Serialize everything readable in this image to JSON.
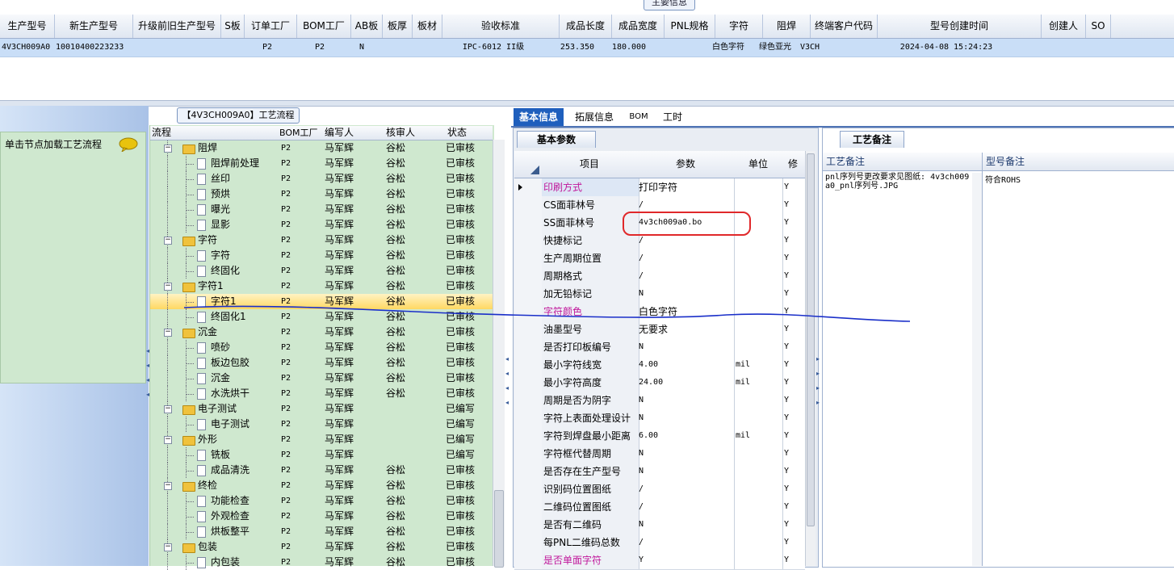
{
  "top_grid": {
    "caption": "主要信息",
    "columns": [
      {
        "label": "生产型号",
        "w": 67
      },
      {
        "label": "新生产型号",
        "w": 96
      },
      {
        "label": "升级前旧生产型号",
        "w": 108
      },
      {
        "label": "S板",
        "w": 28
      },
      {
        "label": "订单工厂",
        "w": 64
      },
      {
        "label": "BOM工厂",
        "w": 66
      },
      {
        "label": "AB板",
        "w": 38
      },
      {
        "label": "板厚",
        "w": 36
      },
      {
        "label": "板材",
        "w": 36
      },
      {
        "label": "验收标准",
        "w": 144
      },
      {
        "label": "成品长度",
        "w": 64
      },
      {
        "label": "成品宽度",
        "w": 64
      },
      {
        "label": "PNL规格",
        "w": 62
      },
      {
        "label": "字符",
        "w": 58
      },
      {
        "label": "阻焊",
        "w": 58
      },
      {
        "label": "终端客户代码",
        "w": 82
      },
      {
        "label": "型号创建时间",
        "w": 202
      },
      {
        "label": "创建人",
        "w": 54
      },
      {
        "label": "SO",
        "w": 30
      }
    ],
    "row": [
      "4V3CH009A0",
      "10010400223233",
      "",
      "",
      "P2",
      "P2",
      "N",
      "",
      "",
      "IPC-6012 II级",
      "253.350",
      "180.000",
      "",
      "白色字符",
      "绿色亚光",
      "V3CH",
      "2024-04-08 15:24:23",
      "",
      ""
    ]
  },
  "left_panel": {
    "title": "单击节点加载工艺流程"
  },
  "process_tree": {
    "caption": "【4V3CH009A0】工艺流程",
    "headers": {
      "name": "流程",
      "bom": "BOM工厂",
      "writer": "编写人",
      "reviewer": "核审人",
      "status": "状态"
    },
    "rows": [
      {
        "level": 0,
        "name": "阻焊",
        "bom": "P2",
        "writer": "马军辉",
        "reviewer": "谷松",
        "status": "已审核"
      },
      {
        "level": 1,
        "name": "阻焊前处理",
        "bom": "P2",
        "writer": "马军辉",
        "reviewer": "谷松",
        "status": "已审核"
      },
      {
        "level": 1,
        "name": "丝印",
        "bom": "P2",
        "writer": "马军辉",
        "reviewer": "谷松",
        "status": "已审核"
      },
      {
        "level": 1,
        "name": "预烘",
        "bom": "P2",
        "writer": "马军辉",
        "reviewer": "谷松",
        "status": "已审核"
      },
      {
        "level": 1,
        "name": "曝光",
        "bom": "P2",
        "writer": "马军辉",
        "reviewer": "谷松",
        "status": "已审核"
      },
      {
        "level": 1,
        "name": "显影",
        "bom": "P2",
        "writer": "马军辉",
        "reviewer": "谷松",
        "status": "已审核"
      },
      {
        "level": 0,
        "name": "字符",
        "bom": "P2",
        "writer": "马军辉",
        "reviewer": "谷松",
        "status": "已审核"
      },
      {
        "level": 1,
        "name": "字符",
        "bom": "P2",
        "writer": "马军辉",
        "reviewer": "谷松",
        "status": "已审核"
      },
      {
        "level": 1,
        "name": "终固化",
        "bom": "P2",
        "writer": "马军辉",
        "reviewer": "谷松",
        "status": "已审核"
      },
      {
        "level": 0,
        "name": "字符1",
        "bom": "P2",
        "writer": "马军辉",
        "reviewer": "谷松",
        "status": "已审核"
      },
      {
        "level": 1,
        "name": "字符1",
        "bom": "P2",
        "writer": "马军辉",
        "reviewer": "谷松",
        "status": "已审核",
        "selected": true
      },
      {
        "level": 1,
        "name": "终固化1",
        "bom": "P2",
        "writer": "马军辉",
        "reviewer": "谷松",
        "status": "已审核"
      },
      {
        "level": 0,
        "name": "沉金",
        "bom": "P2",
        "writer": "马军辉",
        "reviewer": "谷松",
        "status": "已审核"
      },
      {
        "level": 1,
        "name": "喷砂",
        "bom": "P2",
        "writer": "马军辉",
        "reviewer": "谷松",
        "status": "已审核"
      },
      {
        "level": 1,
        "name": "板边包胶",
        "bom": "P2",
        "writer": "马军辉",
        "reviewer": "谷松",
        "status": "已审核"
      },
      {
        "level": 1,
        "name": "沉金",
        "bom": "P2",
        "writer": "马军辉",
        "reviewer": "谷松",
        "status": "已审核"
      },
      {
        "level": 1,
        "name": "水洗烘干",
        "bom": "P2",
        "writer": "马军辉",
        "reviewer": "谷松",
        "status": "已审核"
      },
      {
        "level": 0,
        "name": "电子测试",
        "bom": "P2",
        "writer": "马军辉",
        "reviewer": "",
        "status": "已编写"
      },
      {
        "level": 1,
        "name": "电子测试",
        "bom": "P2",
        "writer": "马军辉",
        "reviewer": "",
        "status": "已编写"
      },
      {
        "level": 0,
        "name": "外形",
        "bom": "P2",
        "writer": "马军辉",
        "reviewer": "",
        "status": "已编写"
      },
      {
        "level": 1,
        "name": "铣板",
        "bom": "P2",
        "writer": "马军辉",
        "reviewer": "",
        "status": "已编写"
      },
      {
        "level": 1,
        "name": "成品清洗",
        "bom": "P2",
        "writer": "马军辉",
        "reviewer": "谷松",
        "status": "已审核"
      },
      {
        "level": 0,
        "name": "终检",
        "bom": "P2",
        "writer": "马军辉",
        "reviewer": "谷松",
        "status": "已审核"
      },
      {
        "level": 1,
        "name": "功能检查",
        "bom": "P2",
        "writer": "马军辉",
        "reviewer": "谷松",
        "status": "已审核"
      },
      {
        "level": 1,
        "name": "外观检查",
        "bom": "P2",
        "writer": "马军辉",
        "reviewer": "谷松",
        "status": "已审核"
      },
      {
        "level": 1,
        "name": "烘板整平",
        "bom": "P2",
        "writer": "马军辉",
        "reviewer": "谷松",
        "status": "已审核"
      },
      {
        "level": 0,
        "name": "包装",
        "bom": "P2",
        "writer": "马军辉",
        "reviewer": "谷松",
        "status": "已审核"
      },
      {
        "level": 1,
        "name": "内包装",
        "bom": "P2",
        "writer": "马军辉",
        "reviewer": "谷松",
        "status": "已审核"
      }
    ]
  },
  "main_tabs": [
    {
      "label": "基本信息",
      "active": true
    },
    {
      "label": "拓展信息",
      "active": false
    },
    {
      "label": "BOM",
      "active": false
    },
    {
      "label": "工时",
      "active": false
    }
  ],
  "params": {
    "tab_label": "基本参数",
    "headers": {
      "item": "项目",
      "param": "参数",
      "unit": "单位",
      "flag": "修"
    },
    "rows": [
      {
        "item": "印刷方式",
        "param": "打印字符",
        "unit": "",
        "flag": "Y",
        "highlight": true,
        "current": true
      },
      {
        "item": "CS面菲林号",
        "param": "/",
        "unit": "",
        "flag": "Y"
      },
      {
        "item": "SS面菲林号",
        "param": "4v3ch009a0.bo",
        "unit": "",
        "flag": "Y",
        "circled": true
      },
      {
        "item": "快捷标记",
        "param": "/",
        "unit": "",
        "flag": "Y"
      },
      {
        "item": "生产周期位置",
        "param": "/",
        "unit": "",
        "flag": "Y"
      },
      {
        "item": "周期格式",
        "param": "/",
        "unit": "",
        "flag": "Y"
      },
      {
        "item": "加无铅标记",
        "param": "N",
        "unit": "",
        "flag": "Y"
      },
      {
        "item": "字符颜色",
        "param": "白色字符",
        "unit": "",
        "flag": "Y",
        "highlight": true
      },
      {
        "item": "油墨型号",
        "param": "无要求",
        "unit": "",
        "flag": "Y"
      },
      {
        "item": "是否打印板编号",
        "param": "N",
        "unit": "",
        "flag": "Y"
      },
      {
        "item": "最小字符线宽",
        "param": "4.00",
        "unit": "mil",
        "flag": "Y"
      },
      {
        "item": "最小字符高度",
        "param": "24.00",
        "unit": "mil",
        "flag": "Y"
      },
      {
        "item": "周期是否为阴字",
        "param": "N",
        "unit": "",
        "flag": "Y"
      },
      {
        "item": "字符上表面处理设计",
        "param": "N",
        "unit": "",
        "flag": "Y"
      },
      {
        "item": "字符到焊盘最小距离",
        "param": "6.00",
        "unit": "mil",
        "flag": "Y"
      },
      {
        "item": "字符框代替周期",
        "param": "N",
        "unit": "",
        "flag": "Y"
      },
      {
        "item": "是否存在生产型号",
        "param": "N",
        "unit": "",
        "flag": "Y"
      },
      {
        "item": "识别码位置图纸",
        "param": "/",
        "unit": "",
        "flag": "Y"
      },
      {
        "item": "二维码位置图纸",
        "param": "/",
        "unit": "",
        "flag": "Y"
      },
      {
        "item": "是否有二维码",
        "param": "N",
        "unit": "",
        "flag": "Y"
      },
      {
        "item": "每PNL二维码总数",
        "param": "/",
        "unit": "",
        "flag": "Y"
      },
      {
        "item": "是否单面字符",
        "param": "Y",
        "unit": "",
        "flag": "Y",
        "highlight": true
      }
    ]
  },
  "notes": {
    "tab_label": "工艺备注",
    "col_process": "工艺备注",
    "col_model": "型号备注",
    "process_note": "pnl序列号更改要求见图纸: 4v3ch009a0_pnl序列号.JPG",
    "model_note": "符合ROHS"
  },
  "colors": {
    "accent": "#1f5fbd",
    "highlight_text": "#c0179b",
    "tree_bg": "#cfe8cf",
    "selection": "#ffd862",
    "annotation_red": "#e0282a",
    "annotation_blue": "#1a2fc9"
  }
}
